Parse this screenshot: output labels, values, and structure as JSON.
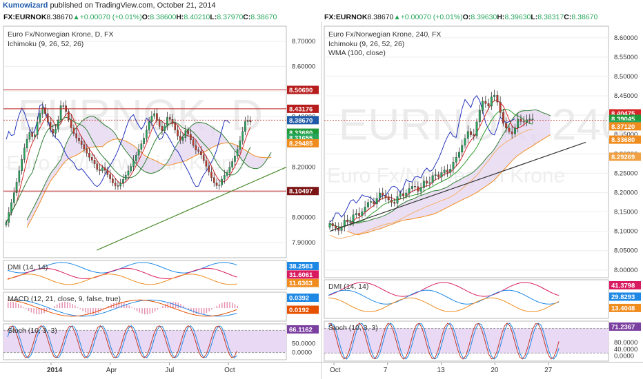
{
  "header": {
    "author": "Kumowizard",
    "published_text": "published on TradingView.com, October 21, 2014",
    "left_quote": {
      "symbol": "FX:EURNOK",
      "last": "8.38670",
      "change": "+0.00070 (+0.01%)",
      "open_label": "O:",
      "open": "8.38600",
      "high_label": "H:",
      "high": "8.40210",
      "low_label": "L:",
      "low": "8.37970",
      "close_label": "C:",
      "close": "8.38670"
    },
    "right_quote": {
      "symbol": "FX:EURNOK",
      "last": "8.38670",
      "change": "+0.00070 (+0.01%)",
      "open_label": "O:",
      "open": "8.39630",
      "high_label": "H:",
      "high": "8.39630",
      "low_label": "L:",
      "low": "8.38317",
      "close_label": "C:",
      "close": "8.38670"
    },
    "up_arrow": "▲"
  },
  "colors": {
    "up": "#26a65b",
    "down": "#c0392b",
    "accent": "#1e5aa8",
    "kumo": "#e6d8f0",
    "tenkan": "#d62728",
    "kijun": "#1f3fbf",
    "chikou": "#2c9c2c",
    "spanA": "#2e7d32",
    "spanB": "#f08c1e"
  },
  "chart_data": [
    {
      "type": "candlestick",
      "title": "Euro Fx/Norwegian Krone, D, FX",
      "indicators": [
        "Ichimoku (9, 26, 52, 26)"
      ],
      "watermark": "EURNOK, D",
      "watermark_sub": "Euro Fx/Norwegian Krone",
      "ylim": [
        7.84,
        8.76
      ],
      "y_ticks": [
        "8.70000",
        "8.60000",
        "8.50000",
        "8.40000",
        "8.30000",
        "8.20000",
        "8.10000",
        "8.00000",
        "7.90000"
      ],
      "y_tick_values": [
        8.7,
        8.6,
        8.5,
        8.4,
        8.3,
        8.2,
        8.1,
        8.0,
        7.9
      ],
      "x_ticks": [
        "2014",
        "Apr",
        "Jul",
        "Oct"
      ],
      "horizontal_levels": [
        8.5069,
        8.43176,
        8.10497
      ],
      "price_labels": [
        {
          "text": "8.50690",
          "value": 8.5069,
          "color": "#b71c1c"
        },
        {
          "text": "8.43176",
          "value": 8.43176,
          "color": "#b71c1c"
        },
        {
          "text": "8.38670",
          "value": 8.3867,
          "color": "#1e5aa8"
        },
        {
          "text": "8.33680",
          "value": 8.3368,
          "color": "#1f9a3a"
        },
        {
          "text": "8.31655",
          "value": 8.31655,
          "color": "#26a65b"
        },
        {
          "text": "8.29485",
          "value": 8.29485,
          "color": "#f08c1e"
        },
        {
          "text": "8.10497",
          "value": 8.10497,
          "color": "#7b1414"
        }
      ],
      "trendline": [
        {
          "x": 0.33,
          "y": 7.87
        },
        {
          "x": 1.0,
          "y": 8.2
        }
      ],
      "close_series": [
        7.98,
        8.05,
        8.12,
        8.2,
        8.28,
        8.34,
        8.31,
        8.4,
        8.44,
        8.38,
        8.33,
        8.36,
        8.46,
        8.42,
        8.36,
        8.32,
        8.3,
        8.27,
        8.24,
        8.22,
        8.18,
        8.2,
        8.17,
        8.14,
        8.12,
        8.14,
        8.17,
        8.2,
        8.24,
        8.28,
        8.32,
        8.38,
        8.42,
        8.37,
        8.34,
        8.4,
        8.38,
        8.33,
        8.3,
        8.35,
        8.31,
        8.27,
        8.26,
        8.22,
        8.18,
        8.14,
        8.12,
        8.16,
        8.18,
        8.22,
        8.26,
        8.32,
        8.39,
        8.38
      ]
    },
    {
      "type": "candlestick",
      "title": "Euro Fx/Norwegian Krone, 240, FX",
      "indicators": [
        "Ichimoku (9, 26, 52, 26)",
        "WMA (100, close)"
      ],
      "watermark": "EURNOK, 240",
      "watermark_sub": "Euro Fx/Norwegian Krone",
      "ylim": [
        7.98,
        8.63
      ],
      "y_ticks": [
        "8.60000",
        "8.55000",
        "8.50000",
        "8.45000",
        "8.40000",
        "8.35000",
        "8.30000",
        "8.25000",
        "8.20000",
        "8.15000",
        "8.10000",
        "8.05000",
        "8.00000"
      ],
      "y_tick_values": [
        8.6,
        8.55,
        8.5,
        8.45,
        8.4,
        8.35,
        8.3,
        8.25,
        8.2,
        8.15,
        8.1,
        8.05,
        8.0
      ],
      "x_ticks": [
        "Oct",
        "7",
        "13",
        "20",
        "27"
      ],
      "price_labels": [
        {
          "text": "8.40475",
          "value": 8.40475,
          "color": "#d62728"
        },
        {
          "text": "8.39045",
          "value": 8.39045,
          "color": "#1f9a3a"
        },
        {
          "text": "8.37600",
          "value": 8.376,
          "color": "#26a65b"
        },
        {
          "text": "8.37120",
          "value": 8.3712,
          "color": "#f08c1e"
        },
        {
          "text": "8.33680",
          "value": 8.3368,
          "color": "#f08c1e"
        },
        {
          "text": "8.29269",
          "value": 8.29269,
          "color": "#f0a040"
        }
      ],
      "trendline": [
        {
          "x": 0.02,
          "y": 8.1
        },
        {
          "x": 0.92,
          "y": 8.33
        }
      ],
      "close_series": [
        8.12,
        8.11,
        8.1,
        8.13,
        8.12,
        8.15,
        8.14,
        8.16,
        8.18,
        8.17,
        8.2,
        8.19,
        8.18,
        8.17,
        8.2,
        8.19,
        8.21,
        8.22,
        8.2,
        8.23,
        8.22,
        8.25,
        8.24,
        8.26,
        8.25,
        8.28,
        8.3,
        8.33,
        8.36,
        8.34,
        8.4,
        8.44,
        8.42,
        8.46,
        8.43,
        8.38,
        8.36,
        8.35,
        8.39,
        8.38,
        8.39,
        8.39
      ]
    }
  ],
  "indicators_left": {
    "dmi": {
      "label": "DMI (14, 14)",
      "values": [
        "38.2583",
        "31.6061",
        "11.6363"
      ],
      "colors": [
        "#1e88e5",
        "#d81b60",
        "#f08c1e"
      ]
    },
    "macd": {
      "label": "MACD (12, 21, close, 9, false, true)",
      "values": [
        "0.0392",
        "0.0192"
      ],
      "colors": [
        "#1e88e5",
        "#e65100"
      ],
      "zero": "0.0000"
    },
    "stoch": {
      "label": "Stoch (10, 3, 3)",
      "values": [
        "66.1162"
      ],
      "colors": [
        "#7b3fa0"
      ],
      "ticks": [
        "50.0000",
        "0.0000"
      ]
    }
  },
  "indicators_right": {
    "dmi": {
      "label": "DMI (14, 14)",
      "values": [
        "41.3798",
        "29.8293",
        "13.4048"
      ],
      "colors": [
        "#d81b60",
        "#1e88e5",
        "#f08c1e"
      ]
    },
    "stoch": {
      "label": "Stoch (10, 3, 3)",
      "values": [
        "71.2367"
      ],
      "colors": [
        "#7b3fa0"
      ],
      "ticks": [
        "80.0000",
        "40.0000",
        "0.0000"
      ]
    }
  }
}
